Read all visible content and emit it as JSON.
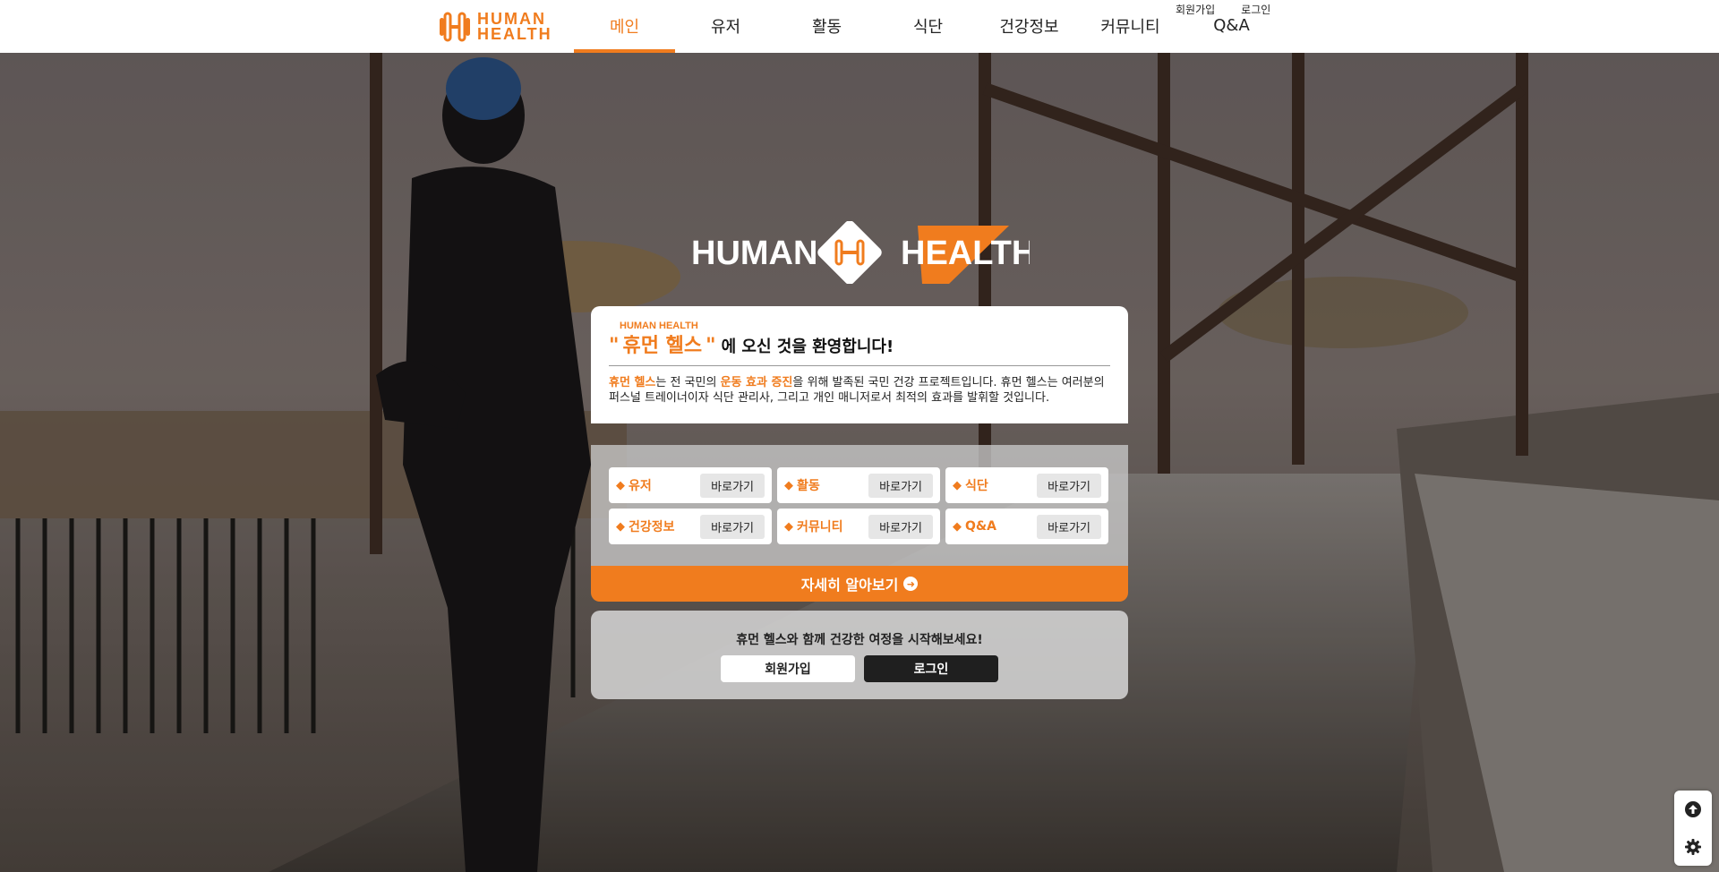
{
  "header": {
    "logo_line1": "HUMAN",
    "logo_line2": "HEALTH",
    "nav": [
      "메인",
      "유저",
      "활동",
      "식단",
      "건강정보",
      "커뮤니티",
      "Q&A"
    ],
    "active_nav": "메인",
    "top_links": {
      "signup": "회원가입",
      "login": "로그인"
    }
  },
  "brand": {
    "left_word": "HUMAN",
    "right_word": "HEALTH",
    "mark_letter": "H"
  },
  "welcome": {
    "small_label": "HUMAN HEALTH",
    "quote_open": "\"",
    "name": "휴먼 헬스",
    "quote_close": "\"",
    "title_rest": "에 오신 것을 환영합니다!",
    "desc_part1": "휴먼 헬스",
    "desc_part2": "는 전 국민의 ",
    "desc_part3": "운동 효과 증진",
    "desc_part4": "을 위해 발족된 국민 건강 프로젝트입니다. 휴먼 헬스는 여러분의 퍼스널 트레이너이자 식단 관리사, 그리고 개인 매니저로서 최적의 효과를 발휘할 것입니다."
  },
  "shortcuts": [
    {
      "label": "유저",
      "button": "바로가기"
    },
    {
      "label": "활동",
      "button": "바로가기"
    },
    {
      "label": "식단",
      "button": "바로가기"
    },
    {
      "label": "건강정보",
      "button": "바로가기"
    },
    {
      "label": "커뮤니티",
      "button": "바로가기"
    },
    {
      "label": "Q&A",
      "button": "바로가기"
    }
  ],
  "more_button": "자세히 알아보기",
  "join": {
    "text": "휴먼 헬스와 함께 건강한 여정을 시작해보세요!",
    "signup": "회원가입",
    "login": "로그인"
  },
  "colors": {
    "accent": "#f07c1e",
    "dark": "#1f1f1f"
  },
  "icons": {
    "scroll_top": "arrow-up-circle-icon",
    "settings": "gear-icon"
  }
}
